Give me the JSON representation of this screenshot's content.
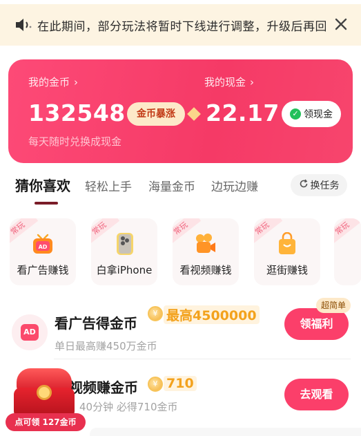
{
  "notice": {
    "text": "在此期间，部分玩法将暂时下线进行调整，升级后再回归",
    "speaker_icon": "speaker-icon",
    "close_icon": "close-icon"
  },
  "wallet": {
    "coins_label": "我的金币",
    "coins_value": "132548",
    "surge_label": "金币暴涨",
    "cash_label": "我的现金",
    "cash_value": "22.17",
    "cash_button": "领现金",
    "subtitle": "每天随时兑换成现金",
    "chevron": "›",
    "colors": {
      "card": "#f73f6a",
      "surge_bg": "#fde9c9",
      "check": "#22c05a"
    }
  },
  "tabs": {
    "items": [
      "猜你喜欢",
      "轻松上手",
      "海量金币",
      "边玩边赚"
    ],
    "active_index": 0,
    "swap_label": "换任务",
    "swap_icon": "refresh-icon"
  },
  "categories": {
    "tag": "常玩",
    "items": [
      {
        "label": "看广告赚钱",
        "icon": "ad-tv-icon"
      },
      {
        "label": "白拿iPhone",
        "icon": "iphone-icon"
      },
      {
        "label": "看视频赚钱",
        "icon": "video-camera-icon"
      },
      {
        "label": "逛街赚钱",
        "icon": "shopping-bag-icon"
      }
    ]
  },
  "tasks": [
    {
      "title": "看广告得金币",
      "reward": "最高4500000",
      "desc": "单日最高赚450万金币",
      "button": "领福利",
      "badge": "超简单",
      "icon_text": "AD"
    },
    {
      "title": "视频赚金币",
      "reward": "710",
      "desc": "40分钟 必得710金币",
      "button": "去观看"
    }
  ],
  "floating": {
    "claim_text": "点可领 127金币",
    "chest_icon": "treasure-chest-icon"
  }
}
